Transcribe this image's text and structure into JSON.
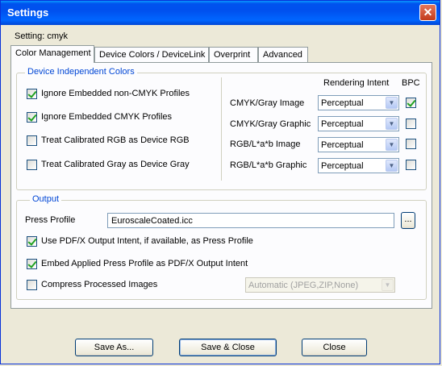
{
  "window": {
    "title": "Settings"
  },
  "setting_label": "Setting: cmyk",
  "tabs": [
    {
      "label": "Color Management",
      "active": true
    },
    {
      "label": "Device Colors / DeviceLink",
      "active": false
    },
    {
      "label": "Overprint",
      "active": false
    },
    {
      "label": "Advanced",
      "active": false
    }
  ],
  "device_independent": {
    "legend": "Device Independent Colors",
    "checkboxes": [
      {
        "label": "Ignore Embedded non-CMYK Profiles",
        "checked": true
      },
      {
        "label": "Ignore Embedded CMYK Profiles",
        "checked": true
      },
      {
        "label": "Treat Calibrated RGB as Device RGB",
        "checked": false
      },
      {
        "label": "Treat Calibrated Gray as Device Gray",
        "checked": false
      }
    ],
    "rendering_intent_header": "Rendering Intent",
    "bpc_header": "BPC",
    "rows": [
      {
        "label": "CMYK/Gray Image",
        "intent": "Perceptual",
        "bpc": true
      },
      {
        "label": "CMYK/Gray Graphic",
        "intent": "Perceptual",
        "bpc": false
      },
      {
        "label": "RGB/L*a*b Image",
        "intent": "Perceptual",
        "bpc": false
      },
      {
        "label": "RGB/L*a*b Graphic",
        "intent": "Perceptual",
        "bpc": false
      }
    ]
  },
  "output": {
    "legend": "Output",
    "press_profile_label": "Press Profile",
    "press_profile_value": "EuroscaleCoated.icc",
    "browse_label": "...",
    "checkboxes": [
      {
        "label": "Use PDF/X Output Intent, if available, as Press Profile",
        "checked": true
      },
      {
        "label": "Embed Applied Press Profile as PDF/X Output Intent",
        "checked": true
      },
      {
        "label": "Compress Processed Images",
        "checked": false
      }
    ],
    "compression_value": "Automatic (JPEG,ZIP,None)"
  },
  "buttons": {
    "save_as": "Save As...",
    "save_close": "Save & Close",
    "close": "Close"
  },
  "icons": {
    "close": "close-icon",
    "dropdown": "chevron-down-icon"
  }
}
